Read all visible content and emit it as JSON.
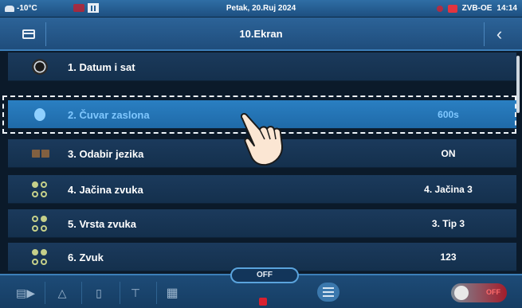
{
  "statusbar": {
    "temperature": "-10°C",
    "date": "Petak, 20.Ruj 2024",
    "device": "ZVB-OE",
    "time": "14:14"
  },
  "titlebar": {
    "title": "10.Ekran",
    "back_icon": "chevron-left-icon",
    "left_icon": "folder-icon"
  },
  "menu": {
    "items": [
      {
        "label": "1. Datum i sat",
        "value": "",
        "icon": "clock-icon"
      },
      {
        "label": "2. Čuvar zaslona",
        "value": "600s",
        "icon": "timer-icon",
        "selected": true
      },
      {
        "label": "3. Odabir jezika",
        "value": "ON",
        "icon": "language-icon"
      },
      {
        "label": "4. Jačina zvuka",
        "value": "4. Jačina 3",
        "icon": "sound-icon"
      },
      {
        "label": "5. Vrsta zvuka",
        "value": "3. Tip 3",
        "icon": "sound-icon"
      },
      {
        "label": "6. Zvuk",
        "value": "123",
        "icon": "sound-icon"
      }
    ]
  },
  "footer": {
    "mode_tab": "OFF",
    "toggle_label": "OFF",
    "icons": [
      "mode-icon",
      "flame-icon",
      "boiler-icon",
      "tap-icon",
      "radiator-icon",
      "menu-icon"
    ]
  },
  "colors": {
    "selected_text": "#7fc7ff",
    "accent": "#2a7fc2",
    "alarm": "#d8202f"
  }
}
